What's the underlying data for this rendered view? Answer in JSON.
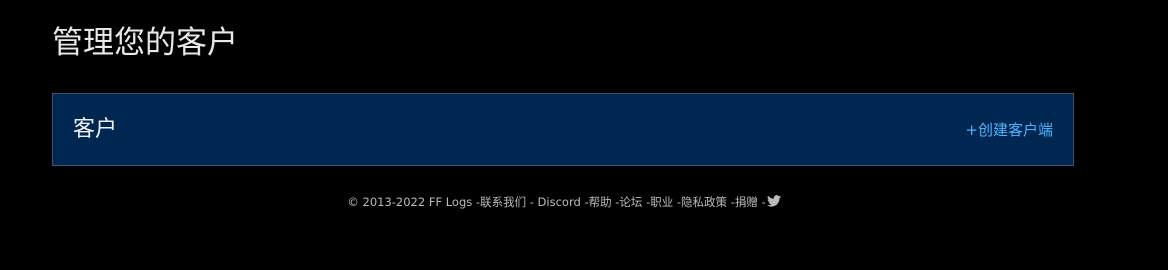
{
  "page": {
    "title": "管理您的客户"
  },
  "panel": {
    "title": "客户",
    "create_link": "+创建客户端"
  },
  "footer": {
    "copyright": "© 2013-2022 FF Logs",
    "links": [
      {
        "label": "联系我们"
      },
      {
        "label": "Discord"
      },
      {
        "label": "帮助"
      },
      {
        "label": "论坛"
      },
      {
        "label": "职业"
      },
      {
        "label": "隐私政策"
      },
      {
        "label": "捐赠"
      }
    ],
    "twitter_icon": "twitter-bird-icon"
  },
  "colors": {
    "background": "#000000",
    "panel_background": "#002752",
    "panel_border": "#40546e",
    "link": "#4fb3ff",
    "footer_text": "#bbbbbb"
  }
}
